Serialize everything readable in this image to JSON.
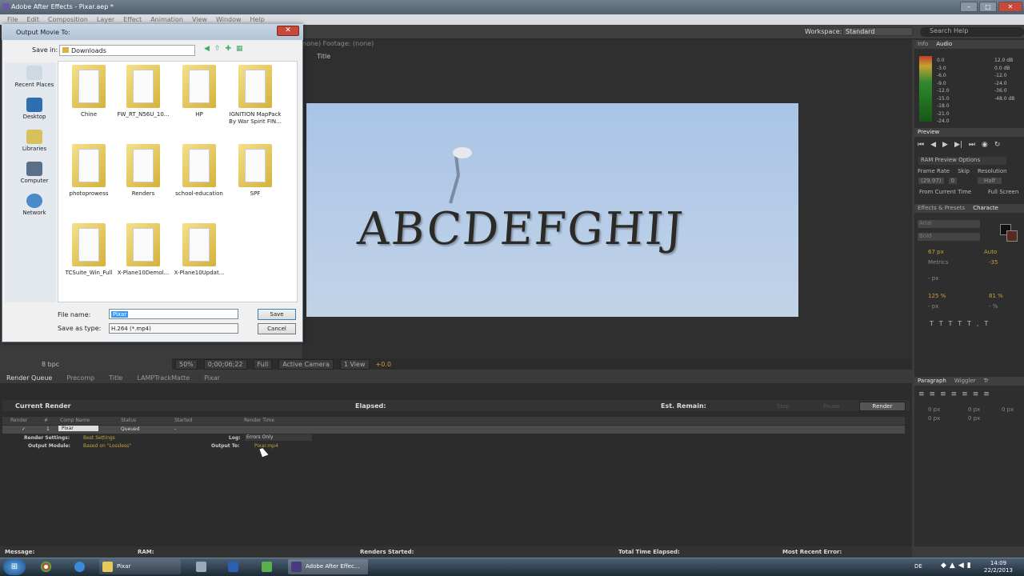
{
  "app_title": "Adobe After Effects - Pixar.aep *",
  "menu": [
    "File",
    "Edit",
    "Composition",
    "Layer",
    "Effect",
    "Animation",
    "View",
    "Window",
    "Help"
  ],
  "workspace": {
    "label": "Workspace:",
    "value": "Standard"
  },
  "search_placeholder": "Search Help",
  "comp": {
    "tabs": "none)       Footage: (none)",
    "tab_title": "Title",
    "text": "ABCDEFGHIJ"
  },
  "viewer": {
    "zoom": "50%",
    "timecode": "0;00;06;22",
    "quality": "Full",
    "camera": "Active Camera",
    "view": "1 View",
    "offset": "+0.0",
    "bpc": "8 bpc"
  },
  "info_panel": {
    "tabs": [
      "Info",
      "Audio"
    ],
    "left_db": [
      "0.0",
      "-3.0",
      "-6.0",
      "-9.0",
      "-12.0",
      "-15.0",
      "-18.0",
      "-21.0",
      "-24.0"
    ],
    "right_db": [
      "12.0 dB",
      "0.0 dB",
      "-12.0",
      "-24.0",
      "-36.0",
      "-48.0 dB"
    ]
  },
  "preview_panel": {
    "title": "Preview",
    "ram_options": "RAM Preview Options",
    "frame_rate": "Frame Rate",
    "skip": "Skip",
    "resolution": "Resolution",
    "fr_value": "(29.97)",
    "skip_value": "0",
    "res_value": "Half",
    "from_current": "From Current Time",
    "full_screen": "Full Screen"
  },
  "character_panel": {
    "tabs": [
      "Effects & Presets",
      "Characte"
    ],
    "font": "Arial",
    "style": "Bold",
    "size": "67 px",
    "tracking": "Auto",
    "leading": "Metrics",
    "kerning": "-35",
    "stroke": "- px",
    "scale_v": "125 %",
    "scale_h": "81 %",
    "baseline": "- px",
    "tsume": "- %"
  },
  "paragraph_panel": {
    "tabs": [
      "Paragraph",
      "Wiggler",
      "Tr"
    ],
    "indent": [
      "0 px",
      "0 px",
      "0 px",
      "0 px",
      "0 px"
    ]
  },
  "render_queue": {
    "tabs": [
      "Render Queue",
      "Precomp",
      "Title",
      "LAMPTrackMatte",
      "Pixar"
    ],
    "current_render": "Current Render",
    "elapsed": "Elapsed:",
    "est_remain": "Est. Remain:",
    "buttons": [
      "Stop",
      "Pause",
      "Render"
    ],
    "columns": [
      "Render",
      "#",
      "Comp Name",
      "Status",
      "Started",
      "Render Time"
    ],
    "row": {
      "num": "1",
      "comp": "Pixar",
      "status": "Queued",
      "started": "-"
    },
    "render_settings_label": "Render Settings:",
    "render_settings": "Best Settings",
    "output_module_label": "Output Module:",
    "output_module": "Based on \"Lossless\"",
    "log_label": "Log:",
    "log": "Errors Only",
    "output_to_label": "Output To:",
    "output_to": "Pixar.mp4"
  },
  "status_bar": {
    "message": "Message:",
    "ram": "RAM:",
    "renders_started": "Renders Started:",
    "total_elapsed": "Total Time Elapsed:",
    "recent_error": "Most Recent Error:"
  },
  "dialog": {
    "title": "Output Movie To:",
    "save_in_label": "Save in:",
    "save_in": "Downloads",
    "places": [
      "Recent Places",
      "Desktop",
      "Libraries",
      "Computer",
      "Network"
    ],
    "files": [
      "Chine",
      "FW_RT_N56U_10...",
      "HP",
      "IGNITION MapPack By War Spirit FIN...",
      "photoprowess",
      "Renders",
      "school-education",
      "SPF",
      "TCSuite_Win_Full",
      "X-Plane10Demol...",
      "X-Plane10Updat..."
    ],
    "file_name_label": "File name:",
    "file_name": "Pixar",
    "save_type_label": "Save as type:",
    "save_type": "H.264 (*.mp4)",
    "save_btn": "Save",
    "cancel_btn": "Cancel"
  },
  "taskbar": {
    "items": [
      "Pixar",
      "Adobe After Effec..."
    ],
    "lang": "DE",
    "time": "14:09",
    "date": "22/2/2013"
  }
}
